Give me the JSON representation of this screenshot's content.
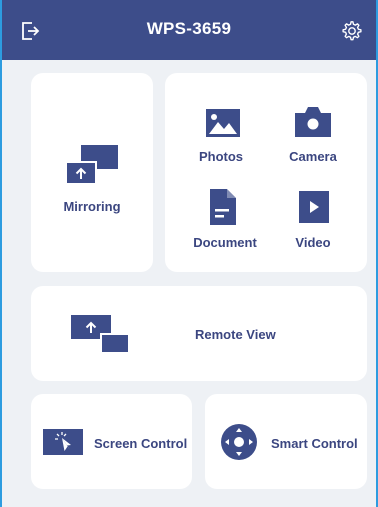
{
  "header": {
    "title": "WPS-3659",
    "exit_icon": "exit-icon",
    "settings_icon": "gear-icon"
  },
  "tiles": {
    "mirroring": {
      "label": "Mirroring",
      "icon": "mirroring-icon"
    },
    "photos": {
      "label": "Photos",
      "icon": "image-icon"
    },
    "camera": {
      "label": "Camera",
      "icon": "camera-icon"
    },
    "document": {
      "label": "Document",
      "icon": "document-icon"
    },
    "video": {
      "label": "Video",
      "icon": "play-icon"
    },
    "remote_view": {
      "label": "Remote View",
      "icon": "remote-view-icon"
    },
    "screen_control": {
      "label": "Screen Control",
      "icon": "cursor-click-icon"
    },
    "smart_control": {
      "label": "Smart Control",
      "icon": "dpad-icon"
    }
  },
  "colors": {
    "header": "#3d4d8a",
    "accent": "#3b4680",
    "background": "#eef1f5",
    "border": "#2d9ce0"
  }
}
